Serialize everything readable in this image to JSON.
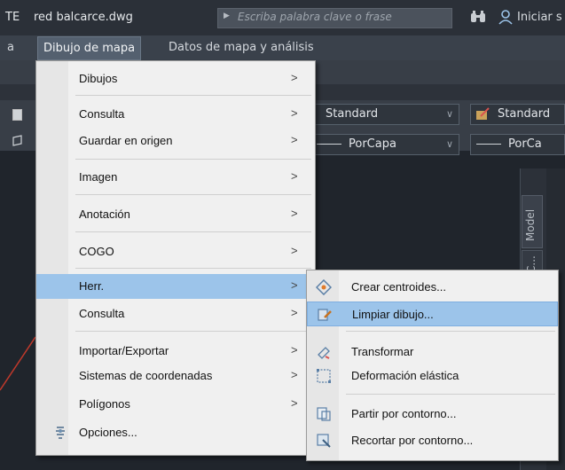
{
  "titlebar": {
    "app_fragment": "TE",
    "doc_title": "red balcarce.dwg",
    "search_placeholder": "Escriba palabra clave o frase",
    "signin": "Iniciar s"
  },
  "menubar": {
    "items": [
      "a",
      "Dibujo de mapa",
      "Datos de mapa y análisis"
    ]
  },
  "ribbon": {
    "text_style": "Standard",
    "dim_style": "Standard",
    "layer_linetype": "PorCapa",
    "layer_lineweight": "PorCa"
  },
  "side_tabs": {
    "model": "Model",
    "second": "C..."
  },
  "main_menu": {
    "items": [
      {
        "label": "Dibujos",
        "arrow": ">"
      },
      {
        "label": "Consulta",
        "arrow": ">"
      },
      {
        "label": "Guardar en origen",
        "arrow": ">"
      },
      {
        "label": "Imagen",
        "arrow": ">"
      },
      {
        "label": "Anotación",
        "arrow": ">"
      },
      {
        "label": "COGO",
        "arrow": ">"
      },
      {
        "label": "Herr.",
        "arrow": ">",
        "highlighted": true
      },
      {
        "label": "Consulta",
        "arrow": ">"
      },
      {
        "label": "Importar/Exportar",
        "arrow": ">"
      },
      {
        "label": "Sistemas de coordenadas",
        "arrow": ">"
      },
      {
        "label": "Polígonos",
        "arrow": ">"
      },
      {
        "label": "Opciones...",
        "icon": "options-icon"
      }
    ]
  },
  "sub_menu": {
    "items": [
      {
        "label": "Crear centroides...",
        "icon": "centroid-icon"
      },
      {
        "label": "Limpiar dibujo...",
        "icon": "cleanup-icon",
        "highlighted": true
      },
      {
        "label": "Transformar",
        "icon": "transform-icon"
      },
      {
        "label": "Deformación elástica",
        "icon": "rubbersheet-icon"
      },
      {
        "label": "Partir por contorno...",
        "icon": "break-icon"
      },
      {
        "label": "Recortar por contorno...",
        "icon": "trim-icon"
      }
    ]
  },
  "colors": {
    "highlight": "#9cc4ea",
    "menu_bg": "#f0f0f0",
    "app_bg": "#1e2229"
  }
}
